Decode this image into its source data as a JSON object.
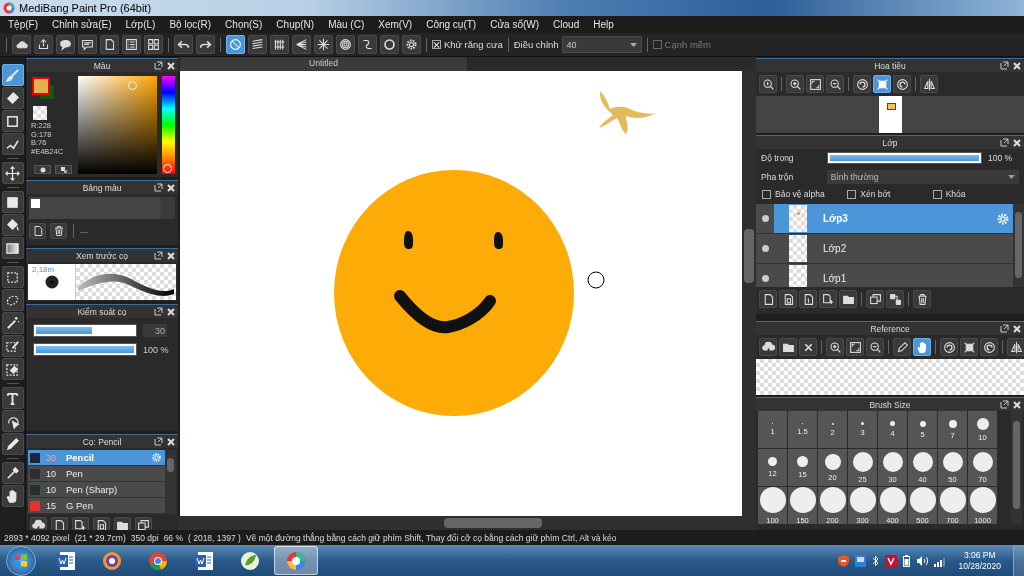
{
  "window": {
    "title": "MediBang Paint Pro (64bit)"
  },
  "menu": [
    "Tệp(F)",
    "Chỉnh sửa(E)",
    "Lớp(L)",
    "Bộ lọc(R)",
    "Chọn(S)",
    "Chụp(N)",
    "Màu (C)",
    "Xem(V)",
    "Công cụ(T)",
    "Cửa sổ(W)",
    "Cloud",
    "Help"
  ],
  "toolbar": {
    "groups": [
      [
        {
          "kind": "cloud",
          "selected": false
        },
        {
          "kind": "share",
          "selected": false
        },
        {
          "kind": "bubble",
          "selected": false
        },
        {
          "kind": "comment",
          "selected": false
        },
        {
          "kind": "page",
          "selected": false
        },
        {
          "kind": "checklist",
          "selected": false
        },
        {
          "kind": "tiles",
          "selected": false
        }
      ],
      [
        {
          "kind": "undo",
          "selected": false
        },
        {
          "kind": "redo",
          "selected": false
        }
      ],
      [
        {
          "kind": "ban",
          "selected": true
        },
        {
          "kind": "hatch",
          "selected": false
        },
        {
          "kind": "grid",
          "selected": false
        },
        {
          "kind": "perspective",
          "selected": false
        },
        {
          "kind": "radial",
          "selected": false
        },
        {
          "kind": "rings",
          "selected": false
        },
        {
          "kind": "curve",
          "selected": false
        },
        {
          "kind": "ellipse",
          "selected": false
        },
        {
          "kind": "gear",
          "selected": false
        }
      ]
    ],
    "antialias": {
      "label": "Khử răng cưa",
      "checked": true
    },
    "correction": {
      "label": "Điều chỉnh",
      "value": "40"
    },
    "soft_edge": {
      "label": "Cạnh mềm",
      "checked": false
    }
  },
  "tools": [
    [
      {
        "kind": "brush",
        "selected": true
      },
      {
        "kind": "eraser",
        "selected": false
      },
      {
        "kind": "square",
        "selected": false
      },
      {
        "kind": "polyline",
        "selected": false
      }
    ],
    [
      {
        "kind": "move",
        "selected": false
      }
    ],
    [
      {
        "kind": "block",
        "selected": false
      },
      {
        "kind": "bucket",
        "selected": false
      },
      {
        "kind": "gradient",
        "selected": false
      }
    ],
    [
      {
        "kind": "marquee",
        "selected": false
      },
      {
        "kind": "lasso",
        "selected": false
      },
      {
        "kind": "wand",
        "selected": false
      },
      {
        "kind": "selectpen",
        "selected": false
      },
      {
        "kind": "selecteraser",
        "selected": false
      }
    ],
    [
      {
        "kind": "text",
        "selected": false
      },
      {
        "kind": "pointer",
        "selected": false
      },
      {
        "kind": "blade",
        "selected": false
      }
    ],
    [
      {
        "kind": "dropper",
        "selected": false
      },
      {
        "kind": "hand",
        "selected": false
      }
    ]
  ],
  "color_panel": {
    "title": "Màu",
    "swatches": [
      {
        "color": "#e4b24c"
      },
      {
        "color": "#0b5e0b"
      }
    ],
    "hue": {
      "level": 0.01
    },
    "readings": [
      "R:228",
      "G:178",
      "B:76",
      "#E4B24C"
    ]
  },
  "palette_panel": {
    "title": "Bảng màu",
    "swatches": [
      {
        "color": "#ffffff"
      }
    ],
    "label": "---"
  },
  "brush_preview": {
    "title": "Xem trước cọ",
    "size": "2,18m"
  },
  "brush_control": {
    "title": "Kiểm soát cọ",
    "sliders": [
      {
        "kind": "field",
        "level": 0.55,
        "reading": "30"
      },
      {
        "kind": "plain",
        "level": 1,
        "reading": "100 %"
      }
    ]
  },
  "brush_list": {
    "title": "Cọ: Pencil",
    "items": [
      {
        "color": "#1b2636",
        "size": "30",
        "name": "Pencil",
        "selected": true
      },
      {
        "color": "#2e2e2e",
        "size": "10",
        "name": "Pen",
        "selected": false
      },
      {
        "color": "#263030",
        "size": "10",
        "name": "Pen (Sharp)",
        "selected": false
      },
      {
        "color": "#e83030",
        "size": "15",
        "name": "G Pen",
        "selected": false
      }
    ],
    "buttons": [
      {
        "kind": "upload",
        "selected": false
      },
      {
        "kind": "page",
        "selected": false
      },
      {
        "kind": "addpage",
        "selected": false
      },
      {
        "kind": "spage",
        "selected": false
      },
      {
        "kind": "folder",
        "selected": false
      },
      {
        "kind": "duplicate",
        "selected": false
      }
    ]
  },
  "canvas": {
    "tab": "Untitled"
  },
  "navigator": {
    "title": "Hoa tiêu",
    "groups": [
      [
        {
          "kind": "zoom",
          "selected": false
        }
      ],
      [
        {
          "kind": "zoomin",
          "selected": false
        },
        {
          "kind": "fit",
          "selected": false
        },
        {
          "kind": "zoomout",
          "selected": false
        }
      ],
      [
        {
          "kind": "rotleft",
          "selected": false
        },
        {
          "kind": "frame",
          "selected": true
        },
        {
          "kind": "rotright",
          "selected": false
        }
      ],
      [
        {
          "kind": "flip",
          "selected": false
        }
      ]
    ]
  },
  "layers_panel": {
    "title": "Lớp",
    "opacity": {
      "label": "Độ trong",
      "level": 1,
      "reading": "100 %"
    },
    "blend": {
      "label": "Pha trộn",
      "value": "Bình thường"
    },
    "options": [
      {
        "label": "Bảo vệ alpha",
        "checked": false
      },
      {
        "label": "Xén bớt",
        "checked": false
      },
      {
        "label": "Khóa",
        "checked": false
      }
    ],
    "layers": [
      {
        "name": "Lớp3",
        "selected": true,
        "visible": true
      },
      {
        "name": "Lớp2",
        "selected": false,
        "visible": true
      },
      {
        "name": "Lớp1",
        "selected": false,
        "visible": true
      }
    ],
    "groups": [
      [
        {
          "kind": "page",
          "selected": false
        },
        {
          "kind": "spage",
          "selected": false
        },
        {
          "kind": "onepage",
          "selected": false
        },
        {
          "kind": "addpage",
          "selected": false
        },
        {
          "kind": "folder",
          "selected": false
        }
      ],
      [
        {
          "kind": "duplicate",
          "selected": false
        },
        {
          "kind": "merge",
          "selected": false
        }
      ],
      [
        {
          "kind": "trash",
          "selected": false
        }
      ]
    ]
  },
  "reference": {
    "title": "Reference",
    "groups": [
      [
        {
          "kind": "upload",
          "selected": false
        },
        {
          "kind": "folder",
          "selected": false
        },
        {
          "kind": "close",
          "selected": false
        }
      ],
      [
        {
          "kind": "zoomin",
          "selected": false
        },
        {
          "kind": "fit",
          "selected": false
        },
        {
          "kind": "zoomout",
          "selected": false
        }
      ],
      [
        {
          "kind": "pen",
          "selected": false
        },
        {
          "kind": "hand",
          "selected": true
        }
      ],
      [
        {
          "kind": "rotleft",
          "selected": false
        },
        {
          "kind": "frame",
          "selected": false
        },
        {
          "kind": "rotright",
          "selected": false
        }
      ],
      [
        {
          "kind": "flip",
          "selected": false
        }
      ]
    ]
  },
  "brush_size": {
    "title": "Brush Size",
    "sizes": [
      "1",
      "1.5",
      "2",
      "3",
      "4",
      "5",
      "7",
      "10",
      "12",
      "15",
      "20",
      "25",
      "30",
      "40",
      "50",
      "70",
      "100",
      "150",
      "200",
      "300",
      "400",
      "500",
      "700",
      "1000"
    ]
  },
  "status_bar": {
    "size": "2893 * 4092 pixel",
    "paper": "(21 * 29.7cm)",
    "dpi": "350 dpi",
    "zoom": "66 %",
    "position": "( 2018, 1397 )",
    "hint": "Vẽ một đường thẳng bằng cách giữ phím Shift, Thay đổi cỡ cọ bằng cách giữ phím Ctrl, Alt và kéo"
  },
  "taskbar": {
    "apps": [
      {
        "kind": "doc",
        "selected": false
      },
      {
        "kind": "shieldbrowser",
        "selected": false
      },
      {
        "kind": "chrome",
        "selected": false
      },
      {
        "kind": "doc",
        "selected": false
      },
      {
        "kind": "leaf",
        "selected": false
      },
      {
        "kind": "palette",
        "selected": true
      }
    ],
    "tray": [
      {
        "kind": "shield"
      },
      {
        "kind": "network"
      },
      {
        "kind": "bluetooth"
      },
      {
        "kind": "vee"
      },
      {
        "kind": "battery"
      },
      {
        "kind": "speaker"
      },
      {
        "kind": "signal"
      }
    ],
    "time": "3:06 PM",
    "date": "10/28/2020"
  }
}
